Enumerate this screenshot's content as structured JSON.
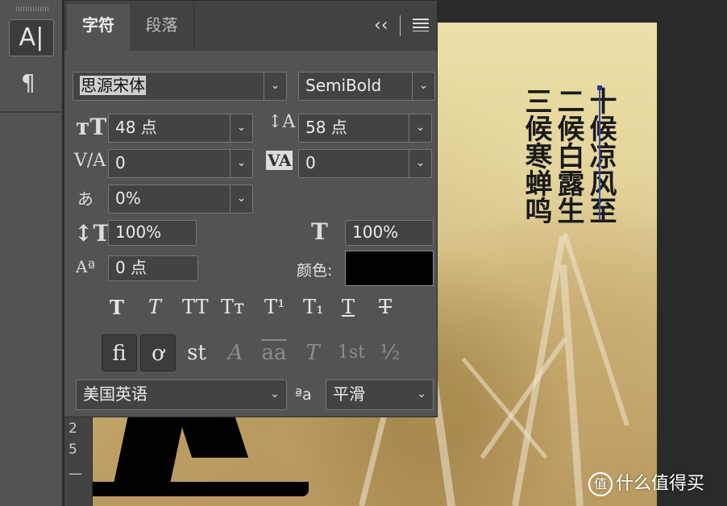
{
  "toolbar": {
    "type_tool_label": "A|",
    "paragraph_tool_label": "¶"
  },
  "panel": {
    "tabs": [
      {
        "label": "字符",
        "active": true
      },
      {
        "label": "段落",
        "active": false
      }
    ],
    "collapse_label": "‹‹",
    "font_family": "思源宋体",
    "font_style": "SemiBold",
    "font_size": "48 点",
    "leading": "58 点",
    "kerning": "0",
    "tracking": "0",
    "tsume": "0%",
    "vertical_scale": "100%",
    "horizontal_scale": "100%",
    "baseline_shift": "0 点",
    "color_label": "颜色:",
    "color_value": "#000000",
    "language": "美国英语",
    "antialias": "平滑",
    "aa_label": "ªa",
    "format_buttons": [
      "T",
      "T",
      "TT",
      "Tт",
      "T¹",
      "T₁",
      "T",
      "T"
    ],
    "opentype_buttons": [
      "ﬁ",
      "ơ",
      "st",
      "A",
      "aa",
      "T",
      "1st",
      "½"
    ]
  },
  "canvas": {
    "poem_columns": [
      "十候凉风至",
      "二候白露生",
      "三候寒蝉鸣"
    ],
    "big_char": "立"
  },
  "ruler": {
    "marks": [
      "2",
      "5",
      "—"
    ]
  },
  "watermark": {
    "icon": "值",
    "text": "什么值得买"
  },
  "colors": {
    "panel_bg": "#535353",
    "field_bg": "#434343",
    "selection": "#cfcfcf"
  }
}
